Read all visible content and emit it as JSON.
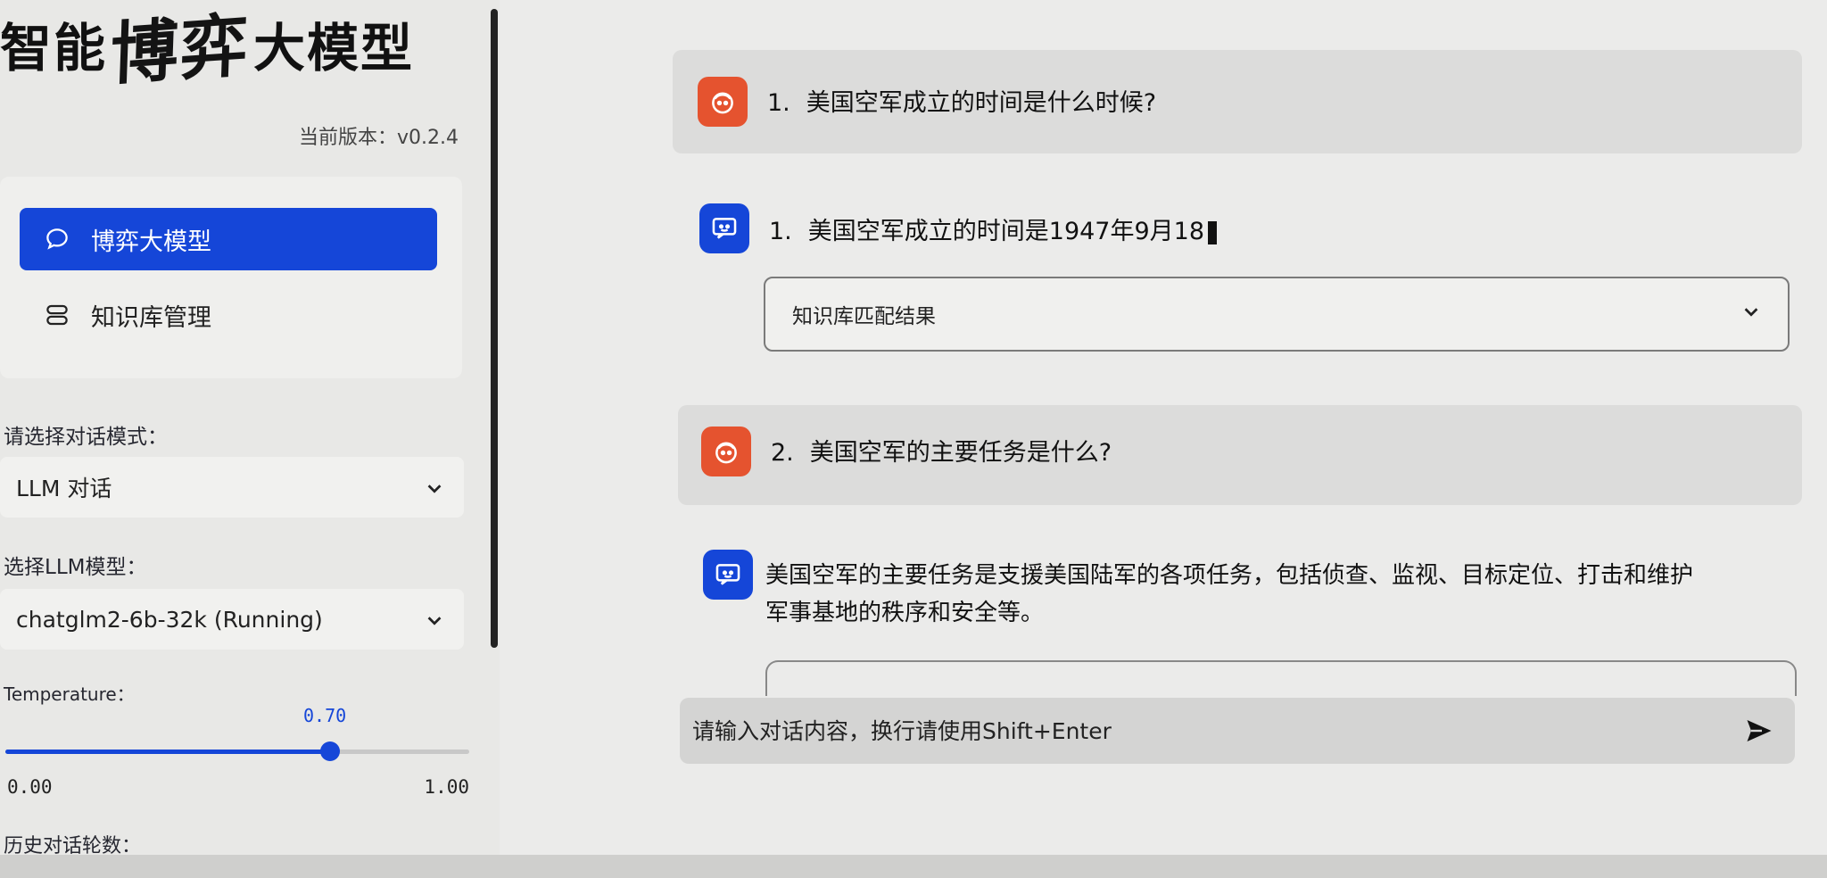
{
  "sidebar": {
    "logo": {
      "part1": "智能",
      "part2": "博弈",
      "part3": "大模型"
    },
    "version": "当前版本：v0.2.4",
    "nav": [
      {
        "label": "博弈大模型",
        "icon": "chat-bubble-icon",
        "active": true
      },
      {
        "label": "知识库管理",
        "icon": "database-icon",
        "active": false
      }
    ],
    "mode_label": "请选择对话模式：",
    "mode_value": "LLM 对话",
    "model_label": "选择LLM模型：",
    "model_value": "chatglm2-6b-32k (Running)",
    "temperature": {
      "label": "Temperature：",
      "value": "0.70",
      "min": "0.00",
      "max": "1.00",
      "fraction": 0.7
    },
    "history_label": "历史对话轮数："
  },
  "chat": {
    "messages": [
      {
        "role": "user",
        "num": "1.",
        "text": "美国空军成立的时间是什么时候?"
      },
      {
        "role": "assistant",
        "num": "1.",
        "text": "美国空军成立的时间是1947年9月18",
        "expander": "知识库匹配结果"
      },
      {
        "role": "user",
        "num": "2.",
        "text": "美国空军的主要任务是什么?"
      },
      {
        "role": "assistant",
        "line1": "美国空军的主要任务是支援美国陆军的各项任务，包括侦查、监视、目标定位、打击和维护",
        "line2": "军事基地的秩序和安全等。"
      }
    ],
    "input_placeholder": "请输入对话内容，换行请使用Shift+Enter"
  },
  "colors": {
    "accent": "#1546d8",
    "user_avatar": "#e5532f"
  }
}
